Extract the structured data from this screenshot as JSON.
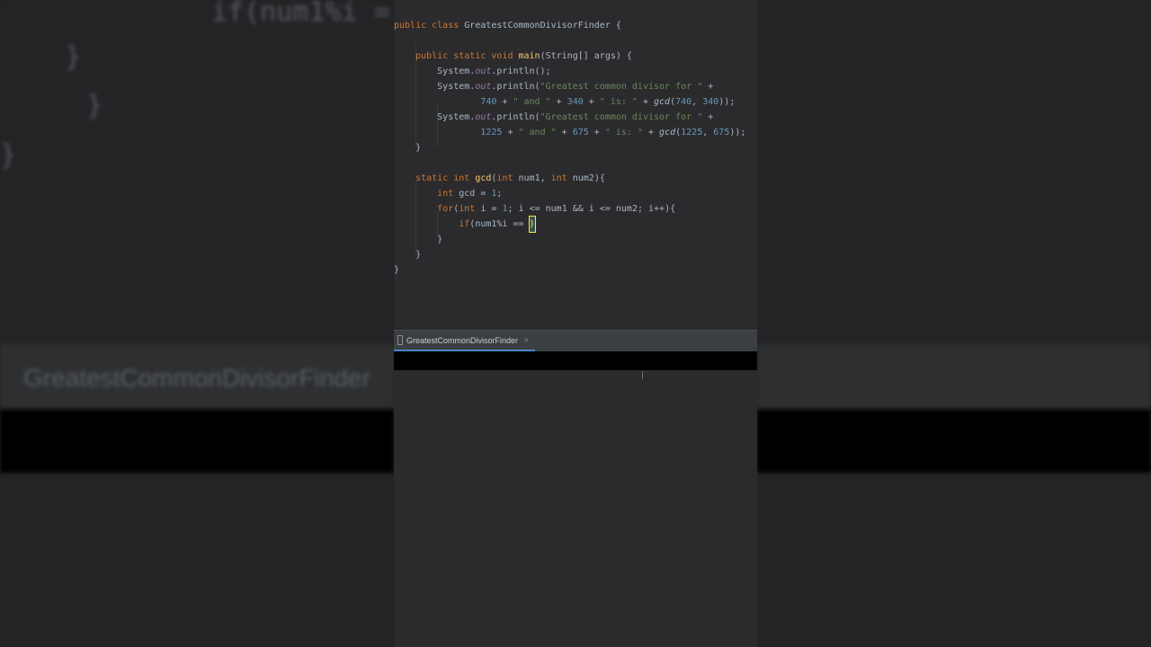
{
  "editor": {
    "lines": [
      {
        "tokens": [
          {
            "c": "kw",
            "t": "public class "
          },
          {
            "c": "",
            "t": "GreatestCommonDivisorFinder {"
          }
        ]
      },
      {
        "tokens": []
      },
      {
        "tokens": [
          {
            "c": "",
            "t": "    "
          },
          {
            "c": "kw",
            "t": "public static void "
          },
          {
            "c": "fn",
            "t": "main"
          },
          {
            "c": "",
            "t": "(String[] args) {"
          }
        ]
      },
      {
        "tokens": [
          {
            "c": "",
            "t": "        System."
          },
          {
            "c": "fld",
            "t": "out"
          },
          {
            "c": "",
            "t": ".println();"
          }
        ]
      },
      {
        "tokens": [
          {
            "c": "",
            "t": "        System."
          },
          {
            "c": "fld",
            "t": "out"
          },
          {
            "c": "",
            "t": ".println("
          },
          {
            "c": "str",
            "t": "\"Greatest common divisor for \""
          },
          {
            "c": "",
            "t": " +"
          }
        ]
      },
      {
        "tokens": [
          {
            "c": "",
            "t": "                "
          },
          {
            "c": "num",
            "t": "740"
          },
          {
            "c": "",
            "t": " + "
          },
          {
            "c": "str",
            "t": "\" and \""
          },
          {
            "c": "",
            "t": " + "
          },
          {
            "c": "num",
            "t": "340"
          },
          {
            "c": "",
            "t": " + "
          },
          {
            "c": "str",
            "t": "\" is: \""
          },
          {
            "c": "",
            "t": " + "
          },
          {
            "c": "it",
            "t": "gcd"
          },
          {
            "c": "",
            "t": "("
          },
          {
            "c": "num",
            "t": "740"
          },
          {
            "c": "",
            "t": ", "
          },
          {
            "c": "num",
            "t": "340"
          },
          {
            "c": "",
            "t": "));"
          }
        ]
      },
      {
        "tokens": [
          {
            "c": "",
            "t": "        System."
          },
          {
            "c": "fld",
            "t": "out"
          },
          {
            "c": "",
            "t": ".println("
          },
          {
            "c": "str",
            "t": "\"Greatest common divisor for \""
          },
          {
            "c": "",
            "t": " +"
          }
        ]
      },
      {
        "tokens": [
          {
            "c": "",
            "t": "                "
          },
          {
            "c": "num",
            "t": "1225"
          },
          {
            "c": "",
            "t": " + "
          },
          {
            "c": "str",
            "t": "\" and \""
          },
          {
            "c": "",
            "t": " + "
          },
          {
            "c": "num",
            "t": "675"
          },
          {
            "c": "",
            "t": " + "
          },
          {
            "c": "str",
            "t": "\" is: \""
          },
          {
            "c": "",
            "t": " + "
          },
          {
            "c": "it",
            "t": "gcd"
          },
          {
            "c": "",
            "t": "("
          },
          {
            "c": "num",
            "t": "1225"
          },
          {
            "c": "",
            "t": ", "
          },
          {
            "c": "num",
            "t": "675"
          },
          {
            "c": "",
            "t": "));"
          }
        ]
      },
      {
        "tokens": [
          {
            "c": "",
            "t": "    }"
          }
        ]
      },
      {
        "tokens": []
      },
      {
        "tokens": [
          {
            "c": "",
            "t": "    "
          },
          {
            "c": "kw",
            "t": "static int "
          },
          {
            "c": "fn",
            "t": "gcd"
          },
          {
            "c": "",
            "t": "("
          },
          {
            "c": "kw",
            "t": "int "
          },
          {
            "c": "",
            "t": "num1, "
          },
          {
            "c": "kw",
            "t": "int "
          },
          {
            "c": "",
            "t": "num2){"
          }
        ]
      },
      {
        "tokens": [
          {
            "c": "",
            "t": "        "
          },
          {
            "c": "kw",
            "t": "int "
          },
          {
            "c": "",
            "t": "gcd = "
          },
          {
            "c": "num",
            "t": "1"
          },
          {
            "c": "",
            "t": ";"
          }
        ]
      },
      {
        "tokens": [
          {
            "c": "",
            "t": "        "
          },
          {
            "c": "kw",
            "t": "for"
          },
          {
            "c": "",
            "t": "("
          },
          {
            "c": "kw",
            "t": "int "
          },
          {
            "c": "",
            "t": "i = "
          },
          {
            "c": "num",
            "t": "1"
          },
          {
            "c": "",
            "t": "; i <= num1 && i <= num2; i++){"
          }
        ]
      },
      {
        "tokens": [
          {
            "c": "",
            "t": "            "
          },
          {
            "c": "kw",
            "t": "if"
          },
          {
            "c": "",
            "t": "(num1%i == "
          },
          {
            "c": "caret",
            "t": ")"
          }
        ]
      },
      {
        "tokens": [
          {
            "c": "",
            "t": "        }"
          }
        ]
      },
      {
        "tokens": [
          {
            "c": "",
            "t": "    }"
          }
        ]
      },
      {
        "tokens": [
          {
            "c": "",
            "t": "}"
          }
        ]
      }
    ]
  },
  "run_tab": {
    "label": "GreatestCommonDivisorFinder",
    "close": "×"
  },
  "background": {
    "left_code": [
      "if(num1%i =",
      "    }",
      "  }",
      "}"
    ],
    "tab_label": "GreatestCommonDivisorFinder"
  },
  "icons": {
    "tab": "class-file-icon",
    "close": "close-icon"
  },
  "colors": {
    "keyword": "#cc7832",
    "function": "#ffc66d",
    "string": "#6a8759",
    "number": "#6897bb",
    "field": "#9876aa",
    "text": "#a9b7c6",
    "caret": "#ffef28"
  }
}
